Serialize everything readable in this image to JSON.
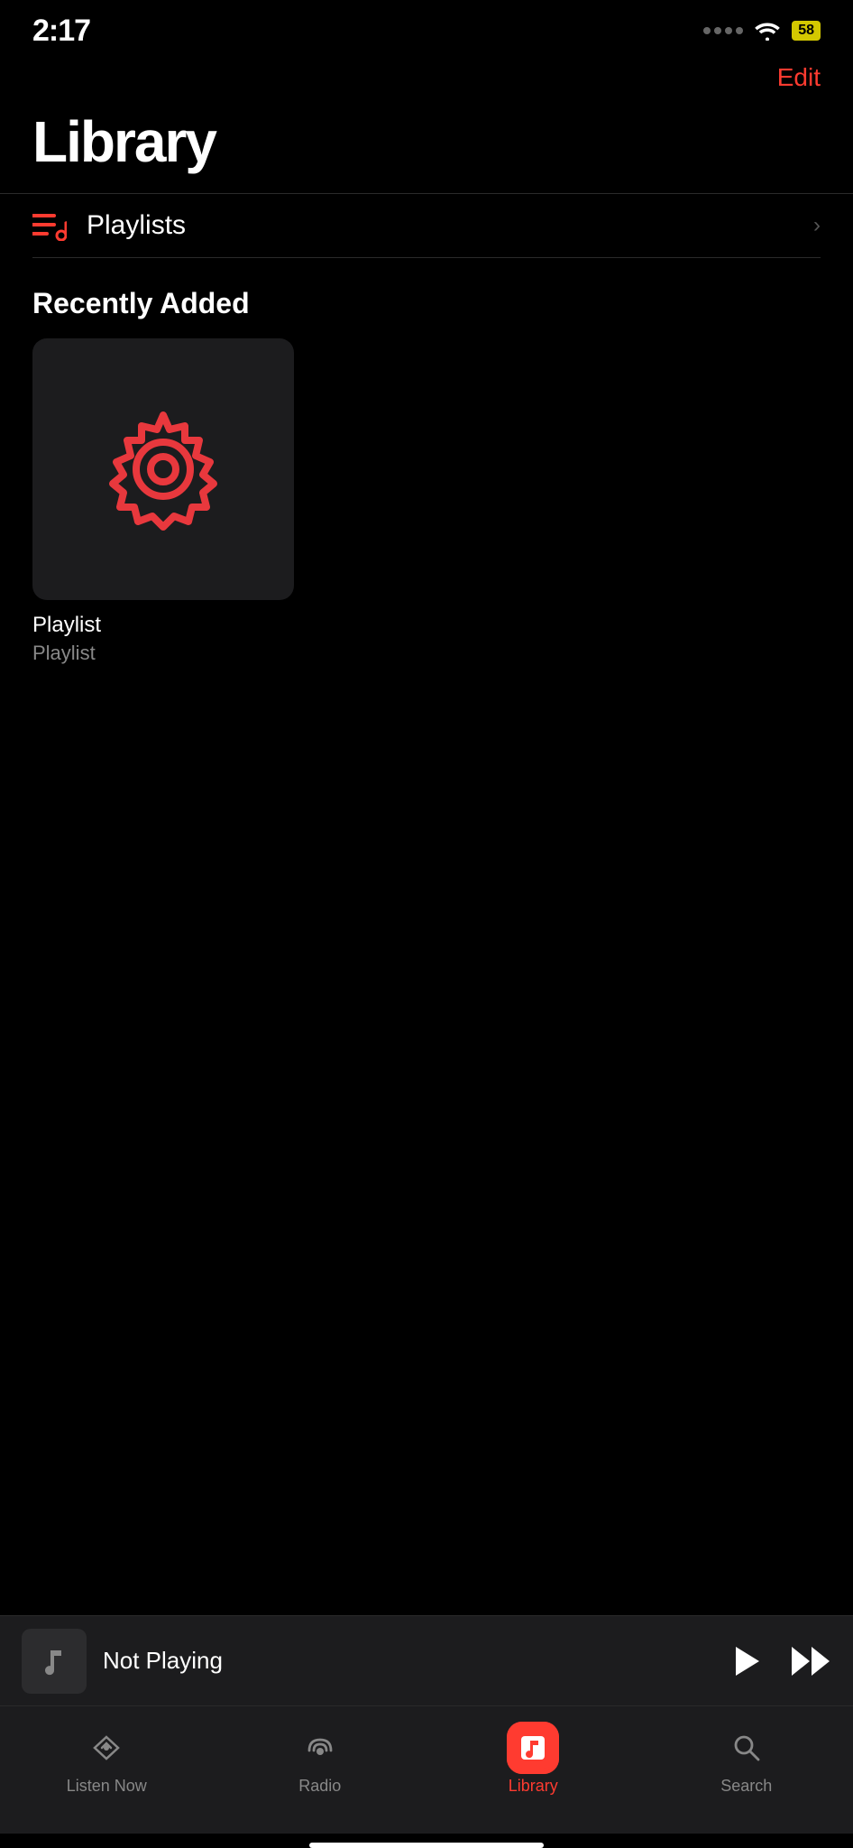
{
  "status": {
    "time": "2:17",
    "battery": "58",
    "battery_color": "#d4c800"
  },
  "header": {
    "edit_label": "Edit"
  },
  "page": {
    "title": "Library"
  },
  "nav_items": [
    {
      "id": "playlists",
      "label": "Playlists",
      "has_chevron": true
    }
  ],
  "sections": [
    {
      "id": "recently-added",
      "title": "Recently Added",
      "items": [
        {
          "id": "playlist-1",
          "name": "Playlist",
          "type": "Playlist"
        }
      ]
    }
  ],
  "mini_player": {
    "title": "Not Playing"
  },
  "tab_bar": {
    "tabs": [
      {
        "id": "listen-now",
        "label": "Listen Now",
        "active": false
      },
      {
        "id": "radio",
        "label": "Radio",
        "active": false
      },
      {
        "id": "library",
        "label": "Library",
        "active": true
      },
      {
        "id": "search",
        "label": "Search",
        "active": false
      }
    ]
  }
}
